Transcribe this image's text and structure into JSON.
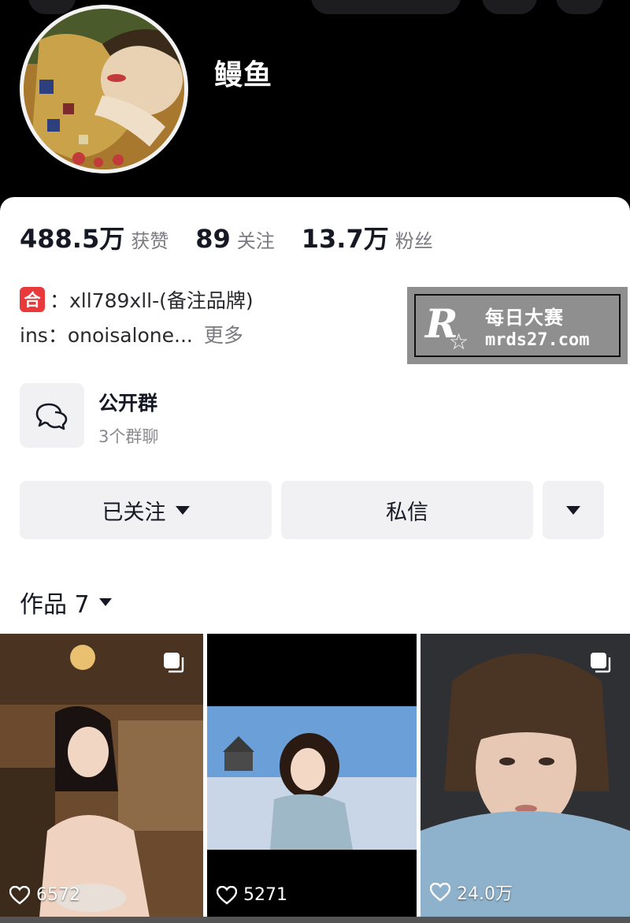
{
  "profile": {
    "nickname": "鳗鱼"
  },
  "stats": [
    {
      "value": "488.5万",
      "label": "获赞"
    },
    {
      "value": "89",
      "label": "关注"
    },
    {
      "value": "13.7万",
      "label": "粉丝"
    }
  ],
  "bio": {
    "badge": "合",
    "line1": "：xll789xll-(备注品牌)",
    "line2": "ins：onoisalone...",
    "more": "更多"
  },
  "group": {
    "title": "公开群",
    "subtitle": "3个群聊",
    "icon": "chat-bubbles-icon"
  },
  "actions": {
    "follow": "已关注",
    "message": "私信"
  },
  "works": {
    "label": "作品 7"
  },
  "watermark": {
    "logo": "R",
    "name": "每日大赛",
    "url": "mrds27.com"
  },
  "posts": [
    {
      "likes": "6572",
      "multi": true
    },
    {
      "likes": "5271",
      "multi": false
    },
    {
      "likes": "24.0万",
      "multi": true
    }
  ],
  "colors": {
    "badge_red": "#e83a3a",
    "button_bg": "#f1f1f3",
    "text_primary": "#161823",
    "text_secondary": "#7a7a80"
  }
}
